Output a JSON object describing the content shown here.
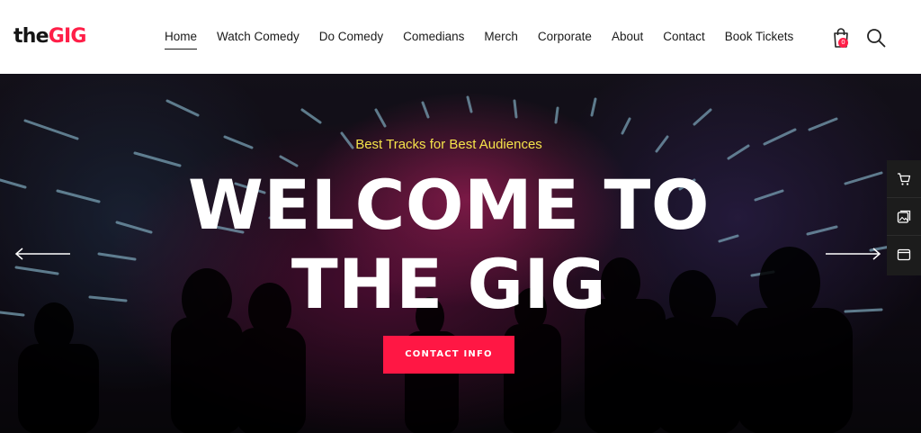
{
  "brand": {
    "logo_prefix": "the",
    "logo_accent": "GIG",
    "accent_color": "#ff1f48"
  },
  "nav": {
    "items": [
      {
        "label": "Home",
        "active": true
      },
      {
        "label": "Watch Comedy"
      },
      {
        "label": "Do Comedy"
      },
      {
        "label": "Comedians"
      },
      {
        "label": "Merch"
      },
      {
        "label": "Corporate"
      },
      {
        "label": "About"
      },
      {
        "label": "Contact"
      },
      {
        "label": "Book Tickets"
      }
    ]
  },
  "header_icons": {
    "cart": "shopping-bag-icon",
    "cart_count": "0",
    "search": "search-icon"
  },
  "hero": {
    "tagline": "Best Tracks for Best Audiences",
    "headline_line1": "WELCOME TO",
    "headline_line2": "THE GIG",
    "cta_label": "CONTACT INFO",
    "cta_color": "#ff1744",
    "tagline_color": "#f5e34a",
    "prev_icon": "arrow-left-icon",
    "next_icon": "arrow-right-icon"
  },
  "side_tools": [
    "cart-icon",
    "image-gallery-icon",
    "browser-window-icon"
  ]
}
